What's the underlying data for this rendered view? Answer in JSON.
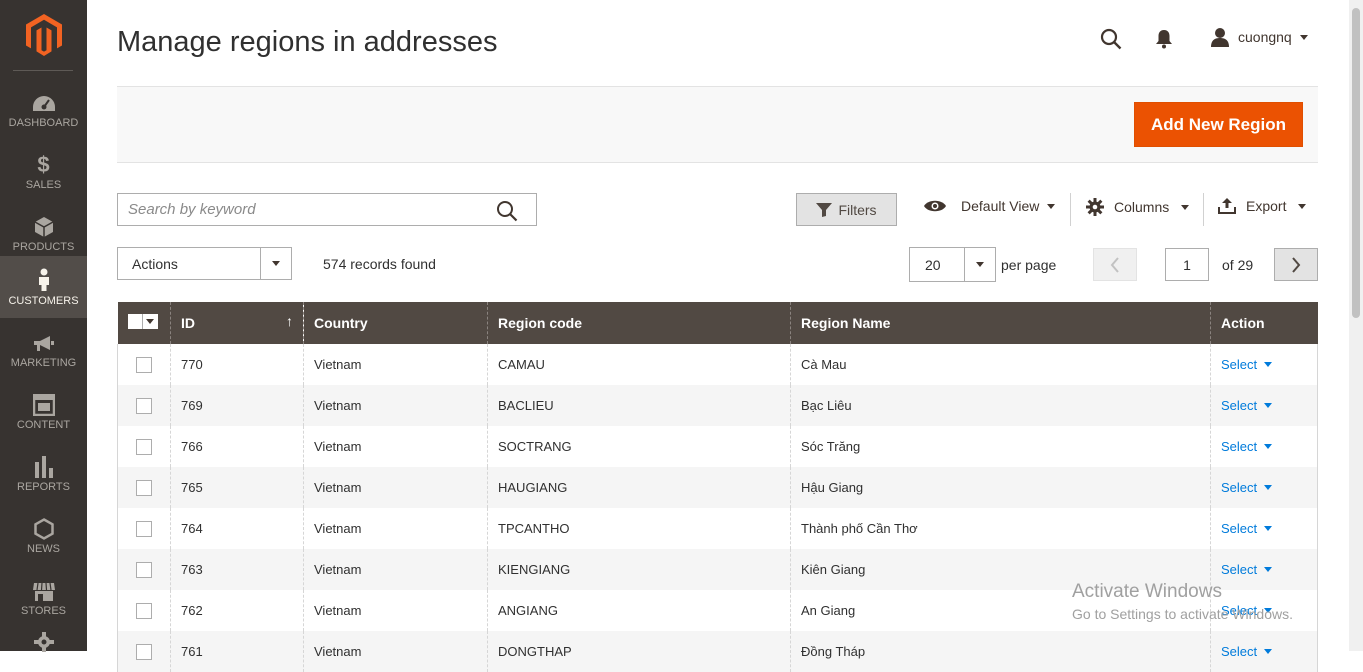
{
  "sidebar": {
    "logo": "magento-logo",
    "items": [
      {
        "label": "DASHBOARD",
        "icon": "dashboard-icon"
      },
      {
        "label": "SALES",
        "icon": "dollar-icon"
      },
      {
        "label": "PRODUCTS",
        "icon": "cube-icon"
      },
      {
        "label": "CUSTOMERS",
        "icon": "person-icon",
        "active": true
      },
      {
        "label": "MARKETING",
        "icon": "megaphone-icon"
      },
      {
        "label": "CONTENT",
        "icon": "layout-icon"
      },
      {
        "label": "REPORTS",
        "icon": "bar-chart-icon"
      },
      {
        "label": "NEWS",
        "icon": "hexagon-icon"
      },
      {
        "label": "STORES",
        "icon": "store-icon"
      }
    ]
  },
  "header": {
    "title": "Manage regions in addresses",
    "username": "cuongnq"
  },
  "actionbar": {
    "add_label": "Add New Region"
  },
  "toolbar": {
    "search_placeholder": "Search by keyword",
    "filters_label": "Filters",
    "view_label": "Default View",
    "columns_label": "Columns",
    "export_label": "Export",
    "actions_label": "Actions",
    "records_text": "574 records found",
    "per_page_value": "20",
    "per_page_label": "per page",
    "current_page": "1",
    "of_pages": "of 29"
  },
  "grid": {
    "columns": [
      "ID",
      "Country",
      "Region code",
      "Region Name",
      "Action"
    ],
    "rows": [
      {
        "id": "770",
        "country": "Vietnam",
        "code": "CAMAU",
        "name": "Cà Mau",
        "action": "Select"
      },
      {
        "id": "769",
        "country": "Vietnam",
        "code": "BACLIEU",
        "name": "Bạc Liêu",
        "action": "Select"
      },
      {
        "id": "766",
        "country": "Vietnam",
        "code": "SOCTRANG",
        "name": "Sóc Trăng",
        "action": "Select"
      },
      {
        "id": "765",
        "country": "Vietnam",
        "code": "HAUGIANG",
        "name": "Hậu Giang",
        "action": "Select"
      },
      {
        "id": "764",
        "country": "Vietnam",
        "code": "TPCANTHO",
        "name": "Thành phố Cần Thơ",
        "action": "Select"
      },
      {
        "id": "763",
        "country": "Vietnam",
        "code": "KIENGIANG",
        "name": "Kiên Giang",
        "action": "Select"
      },
      {
        "id": "762",
        "country": "Vietnam",
        "code": "ANGIANG",
        "name": "An Giang",
        "action": "Select"
      },
      {
        "id": "761",
        "country": "Vietnam",
        "code": "DONGTHAP",
        "name": "Đồng Tháp",
        "action": "Select"
      }
    ]
  },
  "watermark": {
    "line1": "Activate Windows",
    "line2": "Go to Settings to activate Windows."
  },
  "colors": {
    "sidebar_bg": "#373330",
    "accent": "#eb5202",
    "grid_header": "#514943",
    "link": "#007bdb"
  }
}
